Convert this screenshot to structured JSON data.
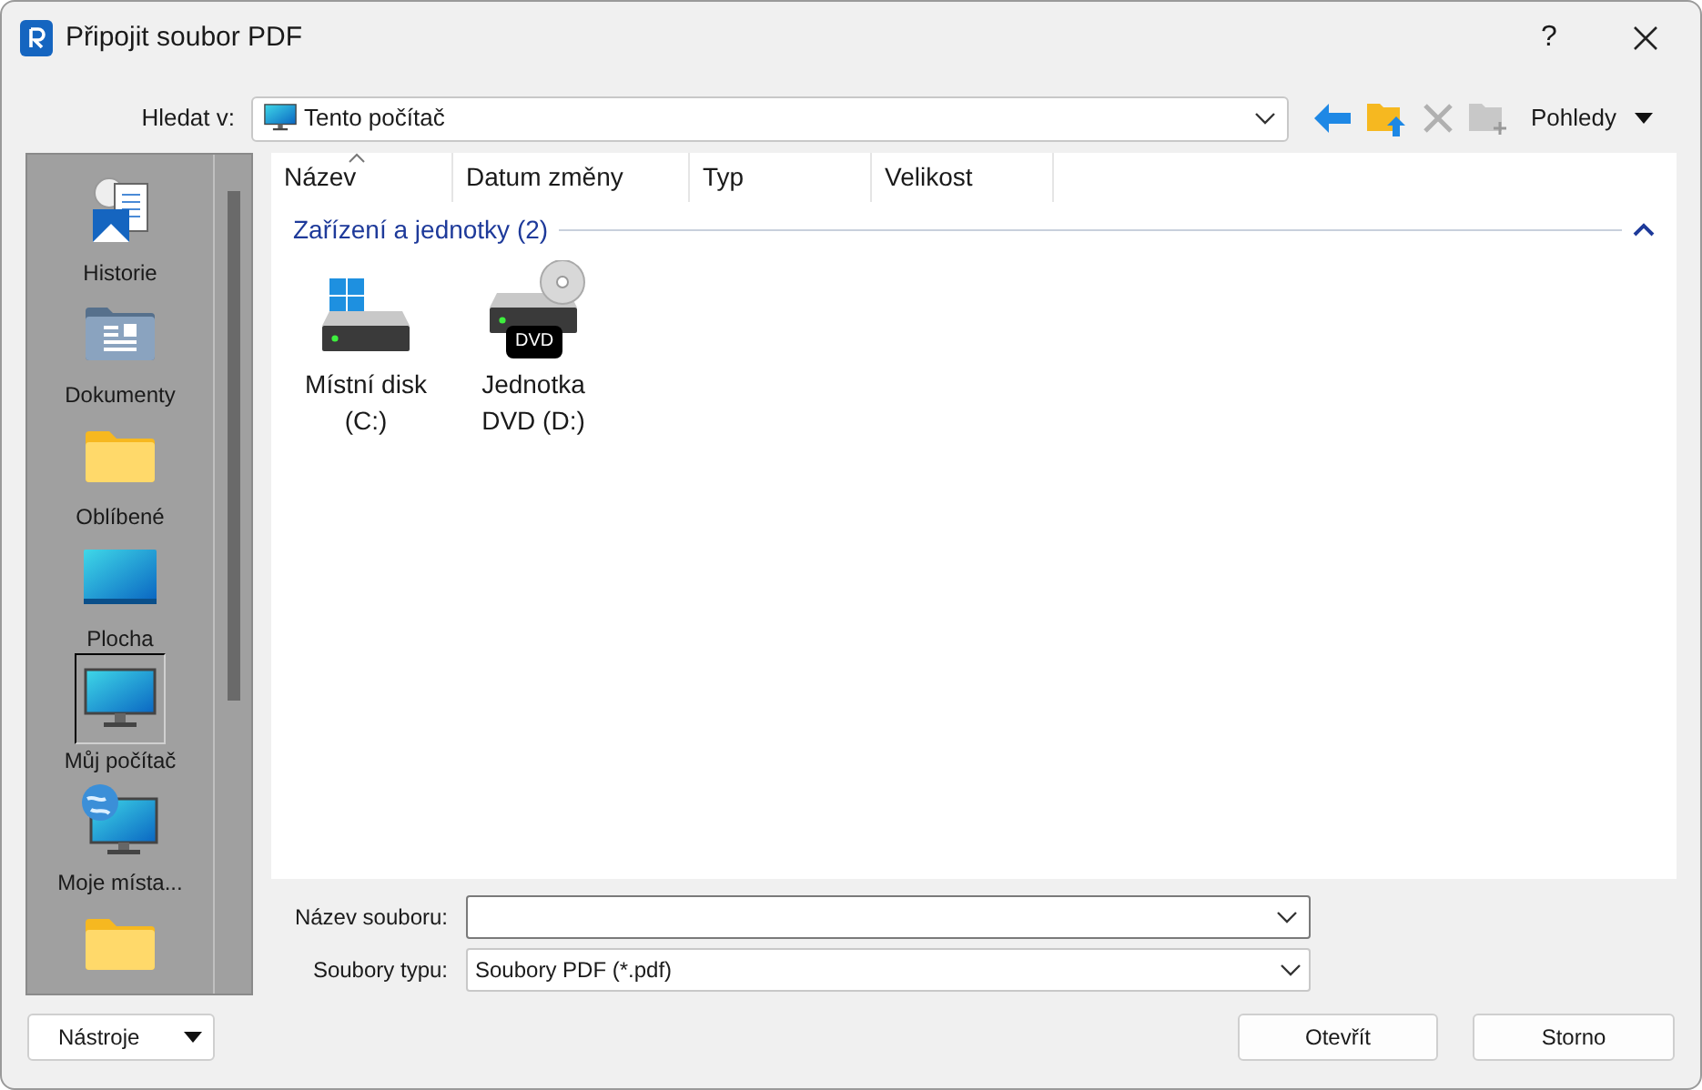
{
  "window": {
    "title": "Připojit soubor PDF",
    "help": "?"
  },
  "look_in": {
    "label": "Hledat v:",
    "value": "Tento počítač"
  },
  "toolbar": [
    {
      "kind": "back",
      "disabled": false
    },
    {
      "kind": "up-folder",
      "disabled": false
    },
    {
      "kind": "delete",
      "disabled": true
    },
    {
      "kind": "new-folder",
      "disabled": true
    }
  ],
  "views_button": "Pohledy",
  "places": [
    {
      "kind": "history",
      "label": "Historie",
      "selected": false
    },
    {
      "kind": "documents",
      "label": "Dokumenty",
      "selected": false
    },
    {
      "kind": "favorites",
      "label": "Oblíbené",
      "selected": false
    },
    {
      "kind": "desktop",
      "label": "Plocha",
      "selected": false
    },
    {
      "kind": "computer",
      "label": "Můj počítač",
      "selected": true
    },
    {
      "kind": "network",
      "label": "Moje místa...",
      "selected": false
    },
    {
      "kind": "folder",
      "selected": false
    }
  ],
  "columns": [
    {
      "label": "Název",
      "sorted": true
    },
    {
      "label": "Datum změny",
      "sorted": false
    },
    {
      "label": "Typ",
      "sorted": false
    },
    {
      "label": "Velikost",
      "sorted": false
    }
  ],
  "group": {
    "title": "Zařízení a jednotky (2)",
    "expanded": true
  },
  "items": [
    {
      "kind": "disk",
      "label": "Místní disk (C:)"
    },
    {
      "kind": "dvd",
      "label": "Jednotka DVD (D:)",
      "badge": "DVD"
    }
  ],
  "file_name": {
    "label": "Název souboru:"
  },
  "file_type": {
    "label": "Soubory typu:",
    "value": "Soubory PDF (*.pdf)"
  },
  "buttons": {
    "tools": "Nástroje",
    "open": "Otevřít",
    "cancel": "Storno"
  }
}
